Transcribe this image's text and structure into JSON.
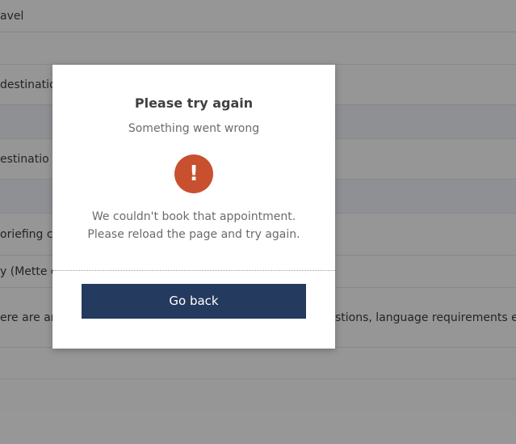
{
  "background": {
    "rows": [
      {
        "text": "avel"
      },
      {
        "text": ""
      },
      {
        "text": "destinatio"
      },
      {
        "text": ""
      },
      {
        "text": "estinatio"
      },
      {
        "text": ""
      },
      {
        "text": "oriefing co"
      },
      {
        "text": "y (Mette c"
      },
      {
        "text": "ere are ar",
        "text_right": "stions, language requirements etc"
      },
      {
        "text": ""
      },
      {
        "text": ""
      }
    ]
  },
  "dialog": {
    "title": "Please try again",
    "subtitle": "Something went wrong",
    "icon": "exclamation-icon",
    "icon_glyph": "!",
    "icon_color": "#c8502f",
    "message_line1": "We couldn't book that appointment.",
    "message_line2": "Please reload the page and try again.",
    "button_label": "Go back",
    "button_color": "#243a5e"
  }
}
